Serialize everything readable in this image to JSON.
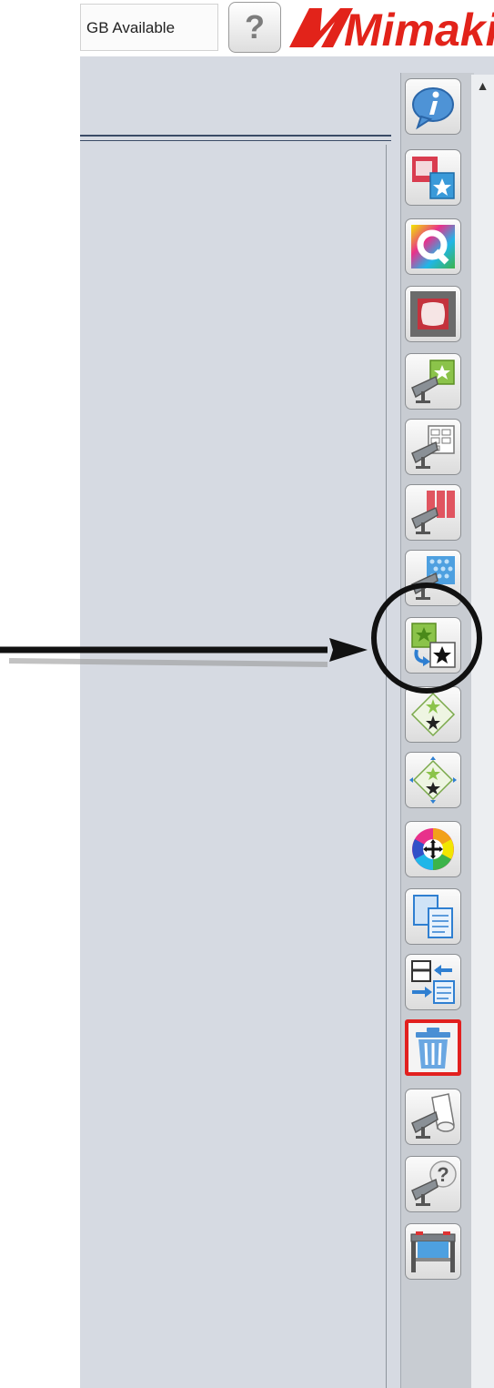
{
  "header": {
    "storage_text": "GB Available",
    "help_glyph": "?",
    "brand": "Mimaki"
  },
  "colors": {
    "brand_red": "#e2231a",
    "highlight_red": "#e2201f",
    "panel_bg": "#d6dae2"
  },
  "scrollbar": {
    "up_glyph": "▲"
  },
  "toolbar": {
    "buttons": [
      {
        "name": "info-icon"
      },
      {
        "name": "job-composite-icon"
      },
      {
        "name": "quality-q-icon"
      },
      {
        "name": "media-frame-icon"
      },
      {
        "name": "print-single-icon"
      },
      {
        "name": "print-layout-icon"
      },
      {
        "name": "print-panels-icon"
      },
      {
        "name": "print-tiling-icon"
      },
      {
        "name": "replace-copy-icon"
      },
      {
        "name": "nest-icon"
      },
      {
        "name": "step-repeat-icon"
      },
      {
        "name": "color-replace-icon"
      },
      {
        "name": "duplicate-job-icon"
      },
      {
        "name": "transfer-job-icon"
      },
      {
        "name": "delete-trash-icon"
      },
      {
        "name": "cut-media-icon"
      },
      {
        "name": "printer-help-icon"
      },
      {
        "name": "printer-device-icon"
      }
    ]
  }
}
